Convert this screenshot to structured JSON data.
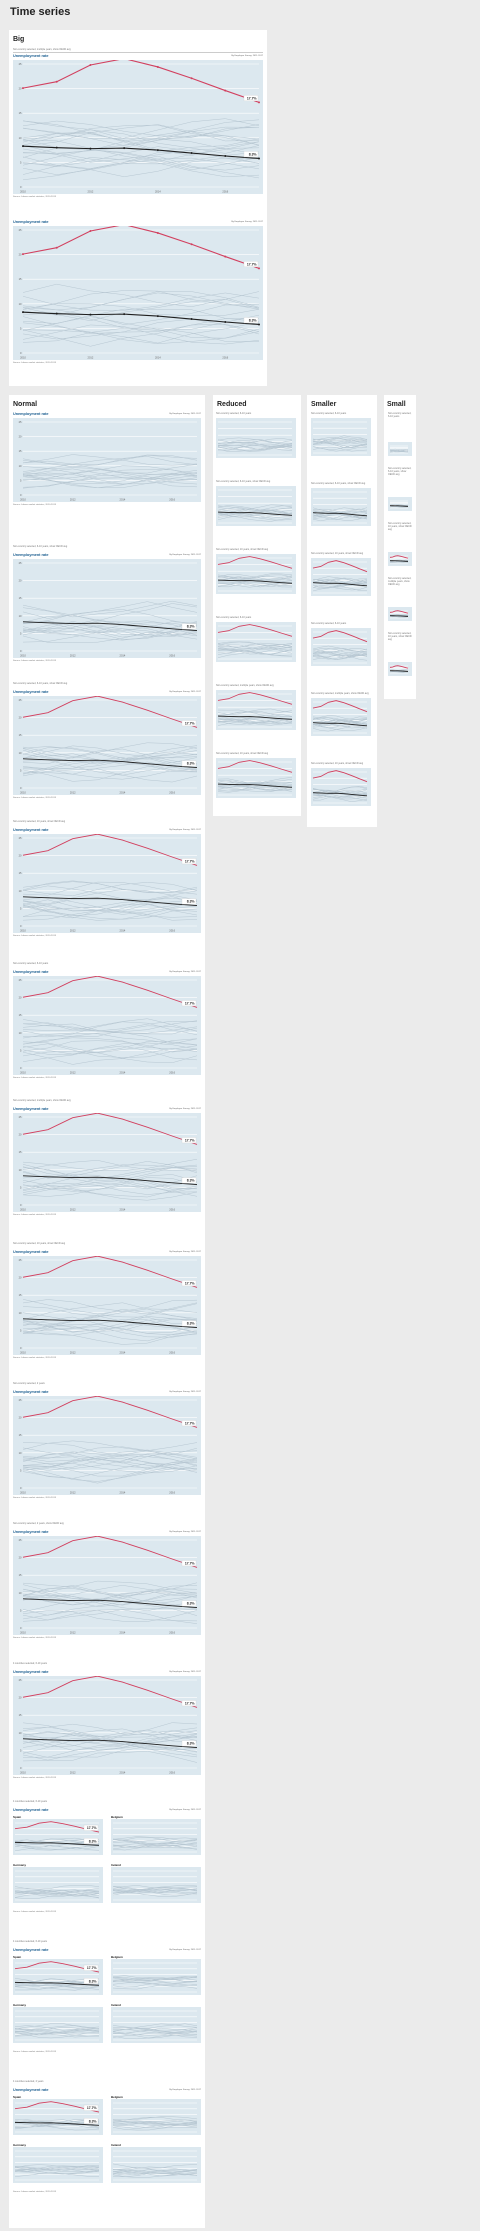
{
  "page": {
    "title": "Time series"
  },
  "sections": {
    "big": "Big",
    "normal": "Normal",
    "reduced": "Reduced",
    "smaller": "Smaller",
    "small": "Small"
  },
  "chart": {
    "title": "Unemployment rate",
    "source_big": "By Employee Survey, 2011-2017",
    "source": "By Employee Survey, 2011-2017",
    "footnote": "Source: Labour market statistics, 2010-2013",
    "footnote_long": "Source: Labour market statistics, 2010-2017"
  },
  "captions": {
    "big": "Non-country selected, multiple years, show OECD avg",
    "n1": "Non-country selected, 6-10 years",
    "n2": "Non-country selected, 6-10 years, show OECD avg",
    "n3": "Non-country selected, 6-10 years, show OECD avg",
    "n4": "Non-country selected, 10 years, show OECD avg",
    "n5": "Non-country selected, 6-10 years",
    "n6": "Non-country selected, multiple years, show OECD avg",
    "n7": "Non-country selected, 10 years, show OECD avg",
    "n8": "Non-country selected, 2 years",
    "n9": "Non-country selected, 2 years, show OECD avg",
    "n10": "4 countries selected, 6-10 years",
    "n11": "4 countries selected, 6-10 years",
    "n12": "4 countries selected, 6-10 years",
    "n13": "4 countries selected, 2 years",
    "r1": "Non-country selected, 6-10 years",
    "r2": "Non-country selected, 6-10 years, show OECD avg",
    "r3": "Non-country selected, 10 years, show OECD avg",
    "r4": "Non-country selected, 6-10 years",
    "r5": "Non-country selected, multiple years, show OECD avg",
    "r6": "Non-country selected, 10 years, show OECD avg",
    "s1": "Non-country selected, 6-10 years",
    "s2": "Non-country selected, 6-10 years, show OECD avg",
    "s3": "Non-country selected, 10 years, show OECD avg",
    "s4": "Non-country selected, 6-10 years",
    "s5": "Non-country selected, multiple years, show OECD avg",
    "s6": "Non-country selected, 10 years, show OECD avg",
    "sm1": "Non-country selected, 6-10 years",
    "sm2": "Non-country selected, 6-10 years, show OECD avg",
    "sm3": "Non-country selected, 10 years, show OECD avg",
    "sm4": "Non-country selected, multiple years, show OECD avg",
    "sm5": "Non-country selected, 10 years, show OECD avg"
  },
  "facets": [
    "Spain",
    "Belgium",
    "Germany",
    "Ireland"
  ],
  "chart_data": {
    "type": "line",
    "title": "Unemployment rate",
    "x": [
      "2010",
      "2011",
      "2012",
      "2013",
      "2014",
      "2015",
      "2016",
      "2017"
    ],
    "ylim": [
      0,
      25
    ],
    "series": [
      {
        "name": "Spain, 2017",
        "values": [
          20.1,
          21.4,
          24.8,
          26.1,
          24.4,
          22.1,
          19.6,
          17.2
        ],
        "color": "#d2405f"
      },
      {
        "name": "OECD - Europe 2017",
        "values": [
          8.3,
          8.0,
          7.8,
          7.9,
          7.5,
          6.9,
          6.3,
          5.8
        ],
        "color": "#1f1f1f"
      }
    ],
    "labels": {
      "highlight": "17.7%",
      "average": "8.3%"
    },
    "grid": true
  }
}
